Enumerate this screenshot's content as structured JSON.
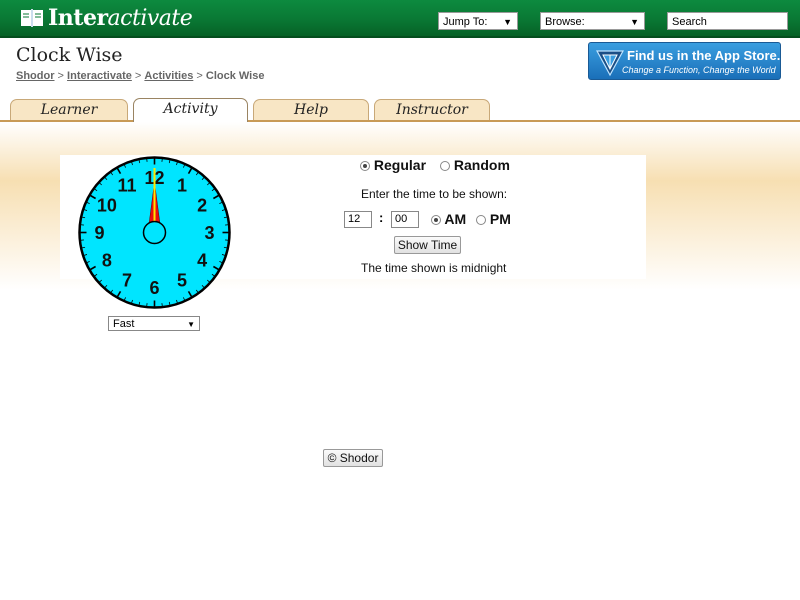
{
  "header": {
    "logo_text_bold": "Inter",
    "logo_text_italic": "activate",
    "jump_to": "Jump To:",
    "browse": "Browse:",
    "search": "Search"
  },
  "page": {
    "title": "Clock Wise",
    "breadcrumb": [
      "Shodor",
      "Interactivate",
      "Activities",
      "Clock Wise"
    ]
  },
  "app_store": {
    "line1": "Find us in the App Store.",
    "line2": "Change a Function, Change the World"
  },
  "tabs": [
    {
      "label": "Learner",
      "active": false
    },
    {
      "label": "Activity",
      "active": true
    },
    {
      "label": "Help",
      "active": false
    },
    {
      "label": "Instructor",
      "active": false
    }
  ],
  "clock": {
    "numbers": [
      "12",
      "1",
      "2",
      "3",
      "4",
      "5",
      "6",
      "7",
      "8",
      "9",
      "10",
      "11"
    ],
    "hour": 12,
    "minute": 0,
    "face_color": "#00e5ff",
    "hand_color": "#e81010"
  },
  "speed": {
    "selected": "Fast"
  },
  "controls": {
    "modes": [
      {
        "label": "Regular",
        "selected": true
      },
      {
        "label": "Random",
        "selected": false
      }
    ],
    "prompt": "Enter the time to be shown:",
    "hour_value": "12",
    "separator": ":",
    "minute_value": "00",
    "ampm": [
      {
        "label": "AM",
        "selected": true
      },
      {
        "label": "PM",
        "selected": false
      }
    ],
    "show_button": "Show Time",
    "result": "The time shown is midnight"
  },
  "footer": {
    "copyright": "© Shodor"
  }
}
